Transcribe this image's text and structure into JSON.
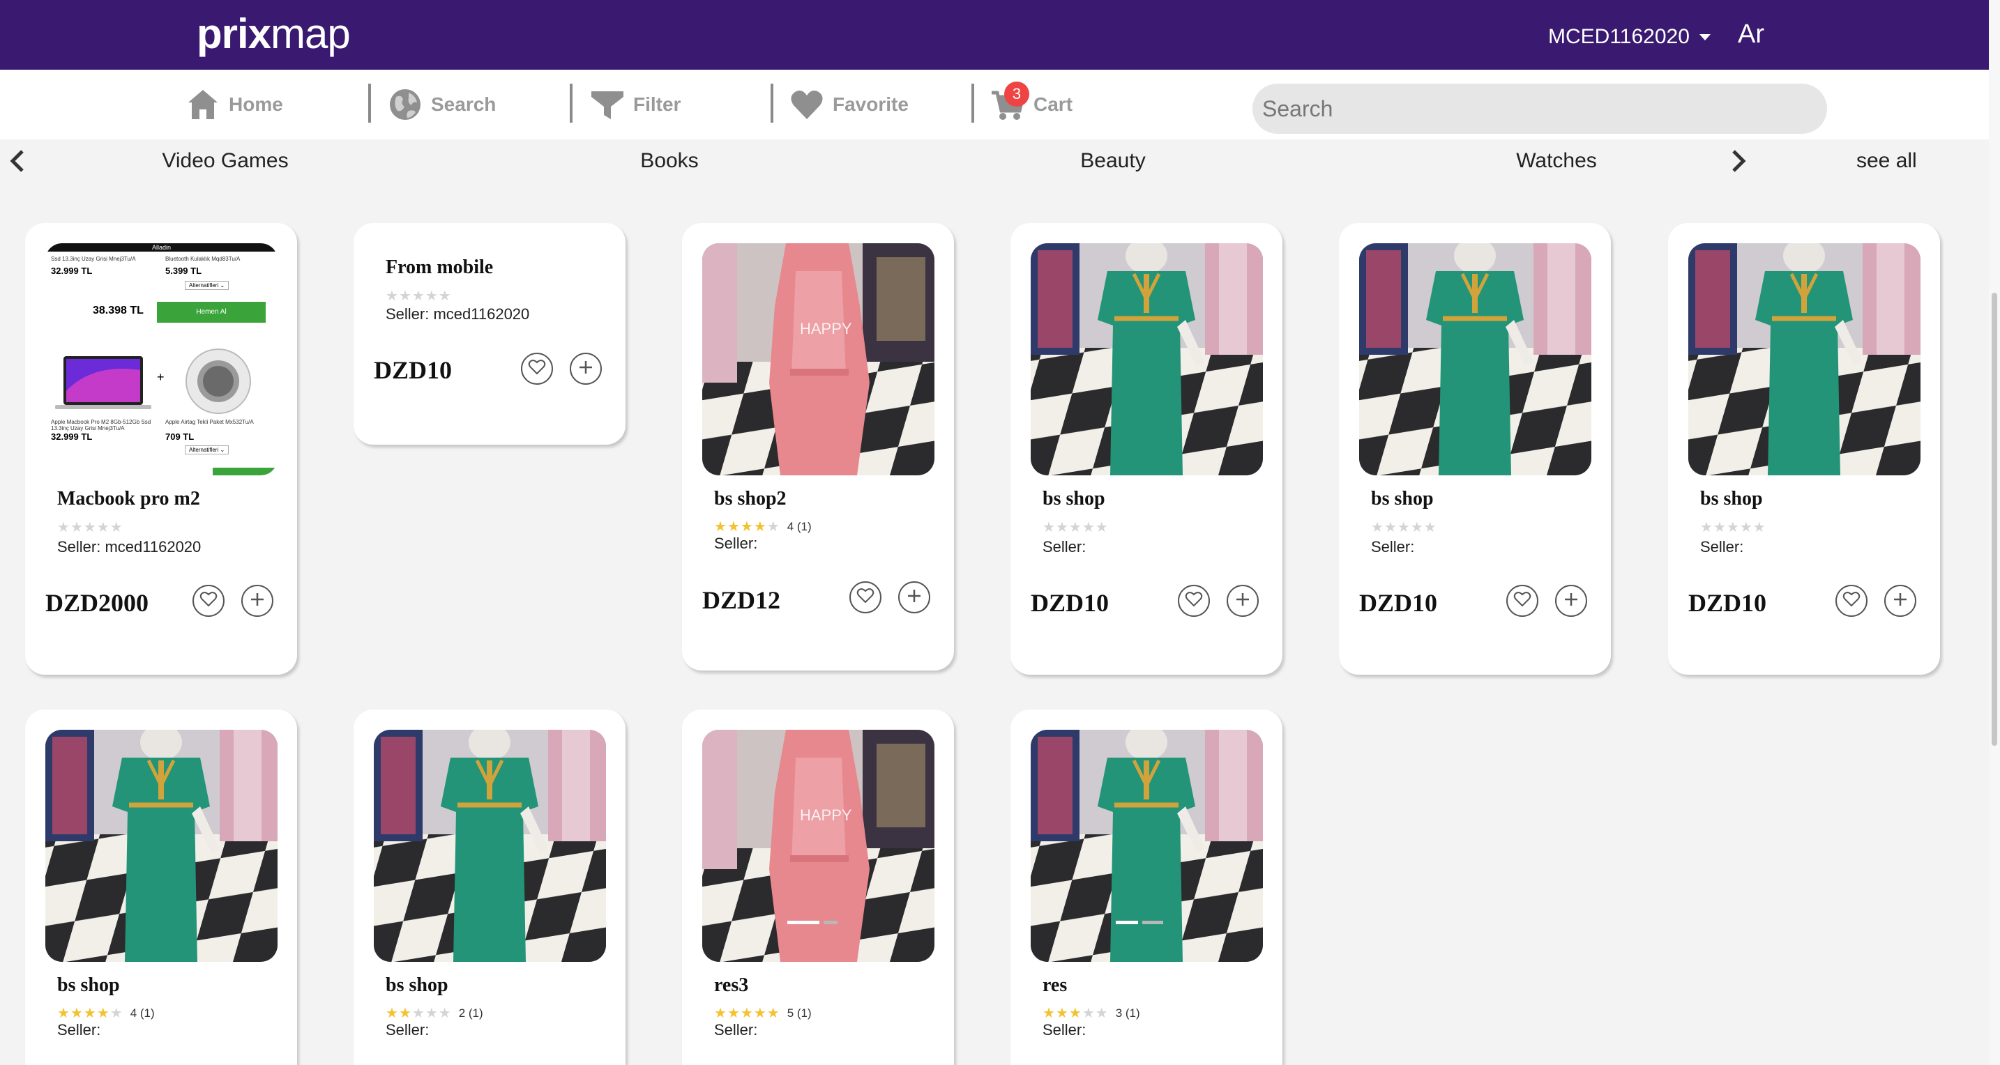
{
  "header": {
    "logo_bold": "prix",
    "logo_light": "map",
    "account": "MCED1162020",
    "lang": "Ar"
  },
  "nav": {
    "items": [
      {
        "label": "Home",
        "icon": "home-icon"
      },
      {
        "label": "Search",
        "icon": "globe-icon"
      },
      {
        "label": "Filter",
        "icon": "filter-icon"
      },
      {
        "label": "Favorite",
        "icon": "heart-icon"
      },
      {
        "label": "Cart",
        "icon": "cart-icon"
      }
    ],
    "cart_count": "3",
    "search_placeholder": "Search"
  },
  "categories": [
    "Video Games",
    "Books",
    "Beauty",
    "Watches"
  ],
  "see_all": "see all",
  "products": [
    {
      "name": "Macbook pro m2",
      "stars": 0,
      "rating_count": "",
      "seller": "Seller: mced1162020",
      "price": "DZD2000",
      "image": "macbook-ad"
    },
    {
      "name": "From mobile",
      "stars": 0,
      "rating_count": "",
      "seller": "Seller: mced1162020",
      "price": "DZD10",
      "image": ""
    },
    {
      "name": "bs shop2",
      "stars": 4,
      "rating_count": "4  (1)",
      "seller": "Seller:",
      "price": "DZD12",
      "image": "pink-robe"
    },
    {
      "name": "bs shop",
      "stars": 0,
      "rating_count": "",
      "seller": "Seller:",
      "price": "DZD10",
      "image": "green-dress"
    },
    {
      "name": "bs shop",
      "stars": 0,
      "rating_count": "",
      "seller": "Seller:",
      "price": "DZD10",
      "image": "green-dress"
    },
    {
      "name": "bs shop",
      "stars": 0,
      "rating_count": "",
      "seller": "Seller:",
      "price": "DZD10",
      "image": "green-dress"
    },
    {
      "name": "bs shop",
      "stars": 4,
      "rating_count": "4  (1)",
      "seller": "Seller:",
      "price": "",
      "image": "green-dress"
    },
    {
      "name": "bs shop",
      "stars": 2,
      "rating_count": "2  (1)",
      "seller": "Seller:",
      "price": "",
      "image": "green-dress"
    },
    {
      "name": "res3",
      "stars": 5,
      "rating_count": "5  (1)",
      "seller": "Seller:",
      "price": "",
      "image": "pink-robe"
    },
    {
      "name": "res",
      "stars": 3,
      "rating_count": "3  (1)",
      "seller": "Seller:",
      "price": "",
      "image": "green-dress"
    }
  ],
  "ad": {
    "banner": "Alladin",
    "line1a": "Ssd 13.3inç Uzay Grisi Mnej3Tu/A",
    "line1b": "Bluetooth Kulaklık Mqd83Tu/A",
    "price1a": "32.999 TL",
    "price1b": "5.399 TL",
    "alt": "Alternatifleri",
    "total": "38.398 TL",
    "buy": "Hemen Al",
    "plus": "+",
    "desc_a": "Apple Macbook Pro M2 8Gb-512Gb Ssd 13.3inç Uzay Grisi Mnej3Tu/A",
    "desc_b": "Apple Airtag Tekli Paket Mx532Tu/A",
    "price2a": "32.999 TL",
    "price2b": "709 TL"
  },
  "colors": {
    "header_bg": "#3a1a70",
    "star_on": "#f2c230",
    "badge": "#e44444",
    "dress": "#239477",
    "robe": "#e7888f"
  }
}
